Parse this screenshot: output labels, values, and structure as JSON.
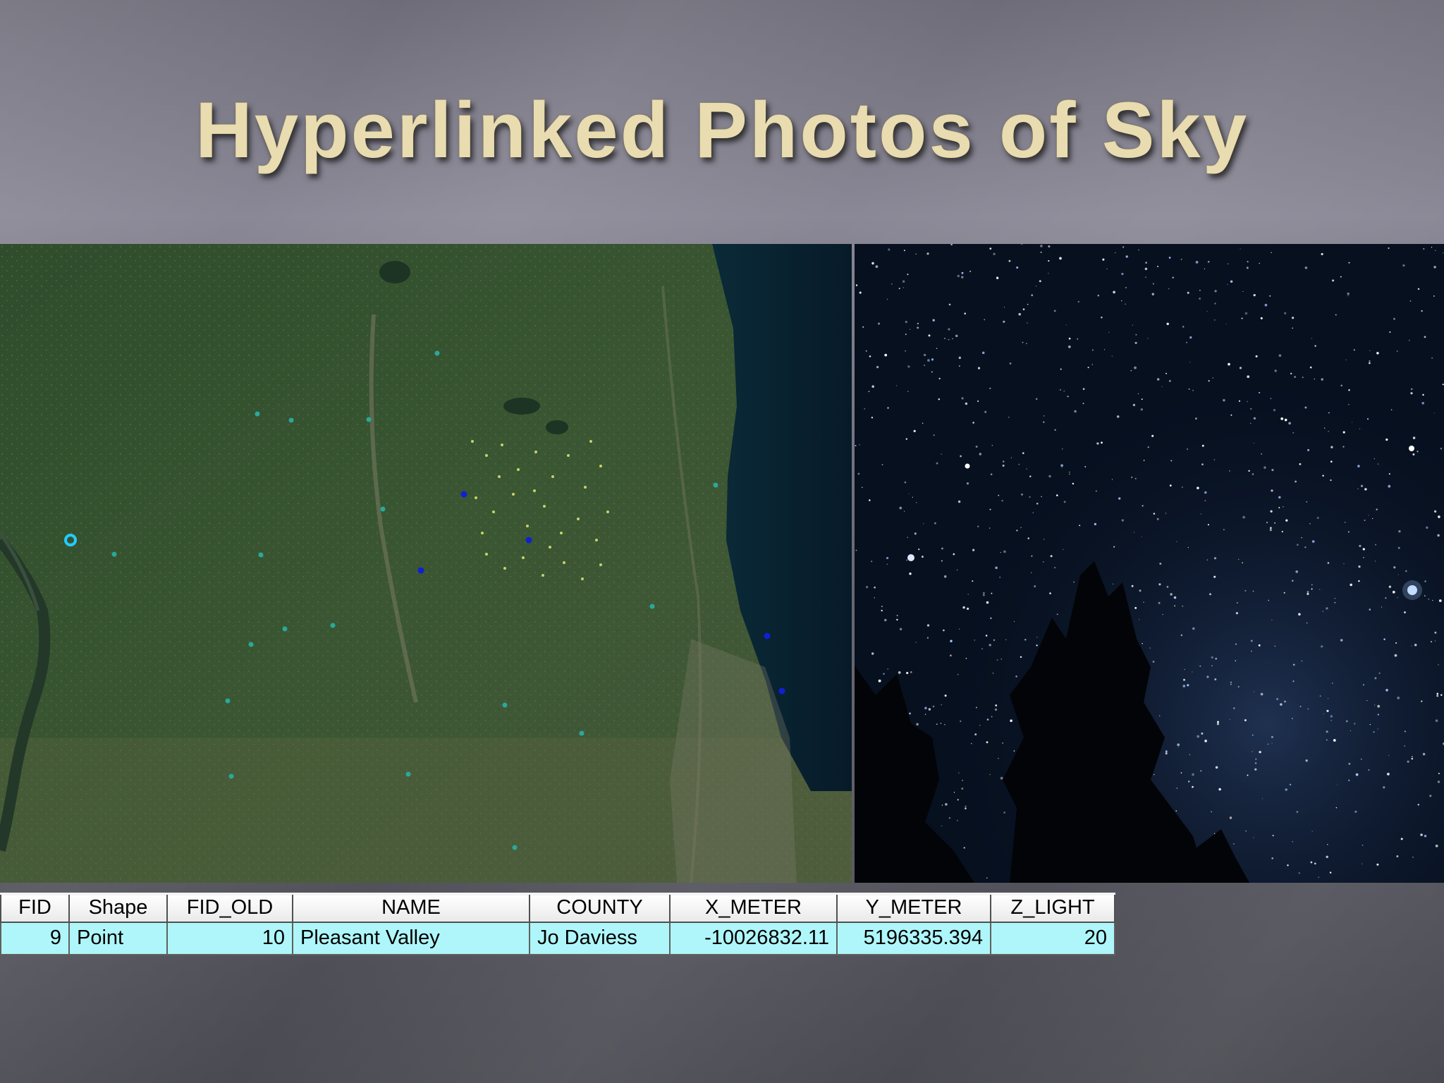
{
  "slide": {
    "title": "Hyperlinked Photos of Sky"
  },
  "map": {
    "description_icon": "satellite-map",
    "selected_point_color": "#22ccff",
    "point_color_dark": "#1020d0",
    "point_color_teal": "#2aa89a"
  },
  "sky_photo": {
    "icon": "night-sky-photo"
  },
  "attribute_table": {
    "columns": [
      "FID",
      "Shape",
      "FID_OLD",
      "NAME",
      "COUNTY",
      "X_METER",
      "Y_METER",
      "Z_LIGHT"
    ],
    "rows": [
      [
        "9",
        "Point",
        "10",
        "Pleasant Valley",
        "Jo Daviess",
        "-10026832.11",
        "5196335.394",
        "20"
      ]
    ]
  },
  "colors": {
    "title": "#e8dcb0",
    "row_highlight": "#aef6fa"
  }
}
